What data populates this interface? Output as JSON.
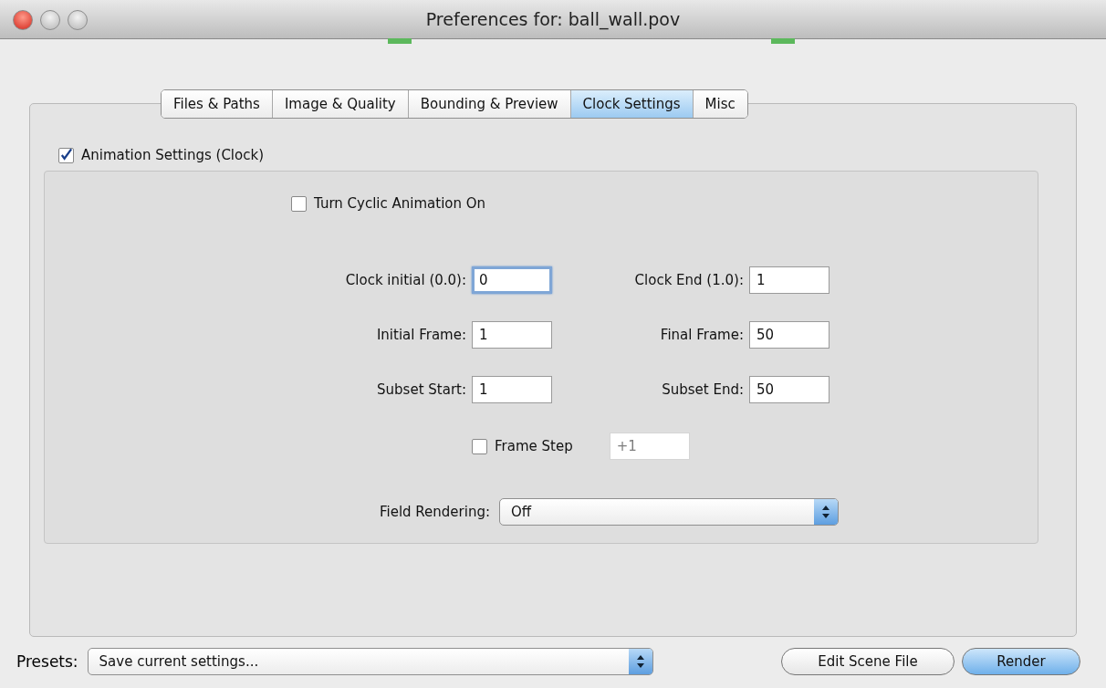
{
  "window": {
    "title": "Preferences for: ball_wall.pov"
  },
  "tabs": [
    {
      "label": "Files & Paths",
      "selected": false
    },
    {
      "label": "Image & Quality",
      "selected": false
    },
    {
      "label": "Bounding & Preview",
      "selected": false
    },
    {
      "label": "Clock Settings",
      "selected": true
    },
    {
      "label": "Misc",
      "selected": false
    }
  ],
  "animation": {
    "label": "Animation Settings (Clock)",
    "checked": true
  },
  "cyclic": {
    "label": "Turn Cyclic Animation On",
    "checked": false
  },
  "field_rows": [
    {
      "left": {
        "label": "Clock initial (0.0):",
        "value": "0",
        "focused": true
      },
      "right": {
        "label": "Clock End (1.0):",
        "value": "1",
        "focused": false
      }
    },
    {
      "left": {
        "label": "Initial Frame:",
        "value": "1",
        "focused": false
      },
      "right": {
        "label": "Final Frame:",
        "value": "50",
        "focused": false
      }
    },
    {
      "left": {
        "label": "Subset Start:",
        "value": "1",
        "focused": false
      },
      "right": {
        "label": "Subset End:",
        "value": "50",
        "focused": false
      }
    }
  ],
  "frame_step": {
    "label": "Frame Step",
    "checked": false,
    "value": "+1",
    "disabled": true
  },
  "field_rendering": {
    "label": "Field Rendering:",
    "value": "Off"
  },
  "presets": {
    "label": "Presets:",
    "value": "Save current settings..."
  },
  "buttons": [
    {
      "label": "Edit Scene File",
      "default": false
    },
    {
      "label": "Render",
      "default": true
    }
  ]
}
